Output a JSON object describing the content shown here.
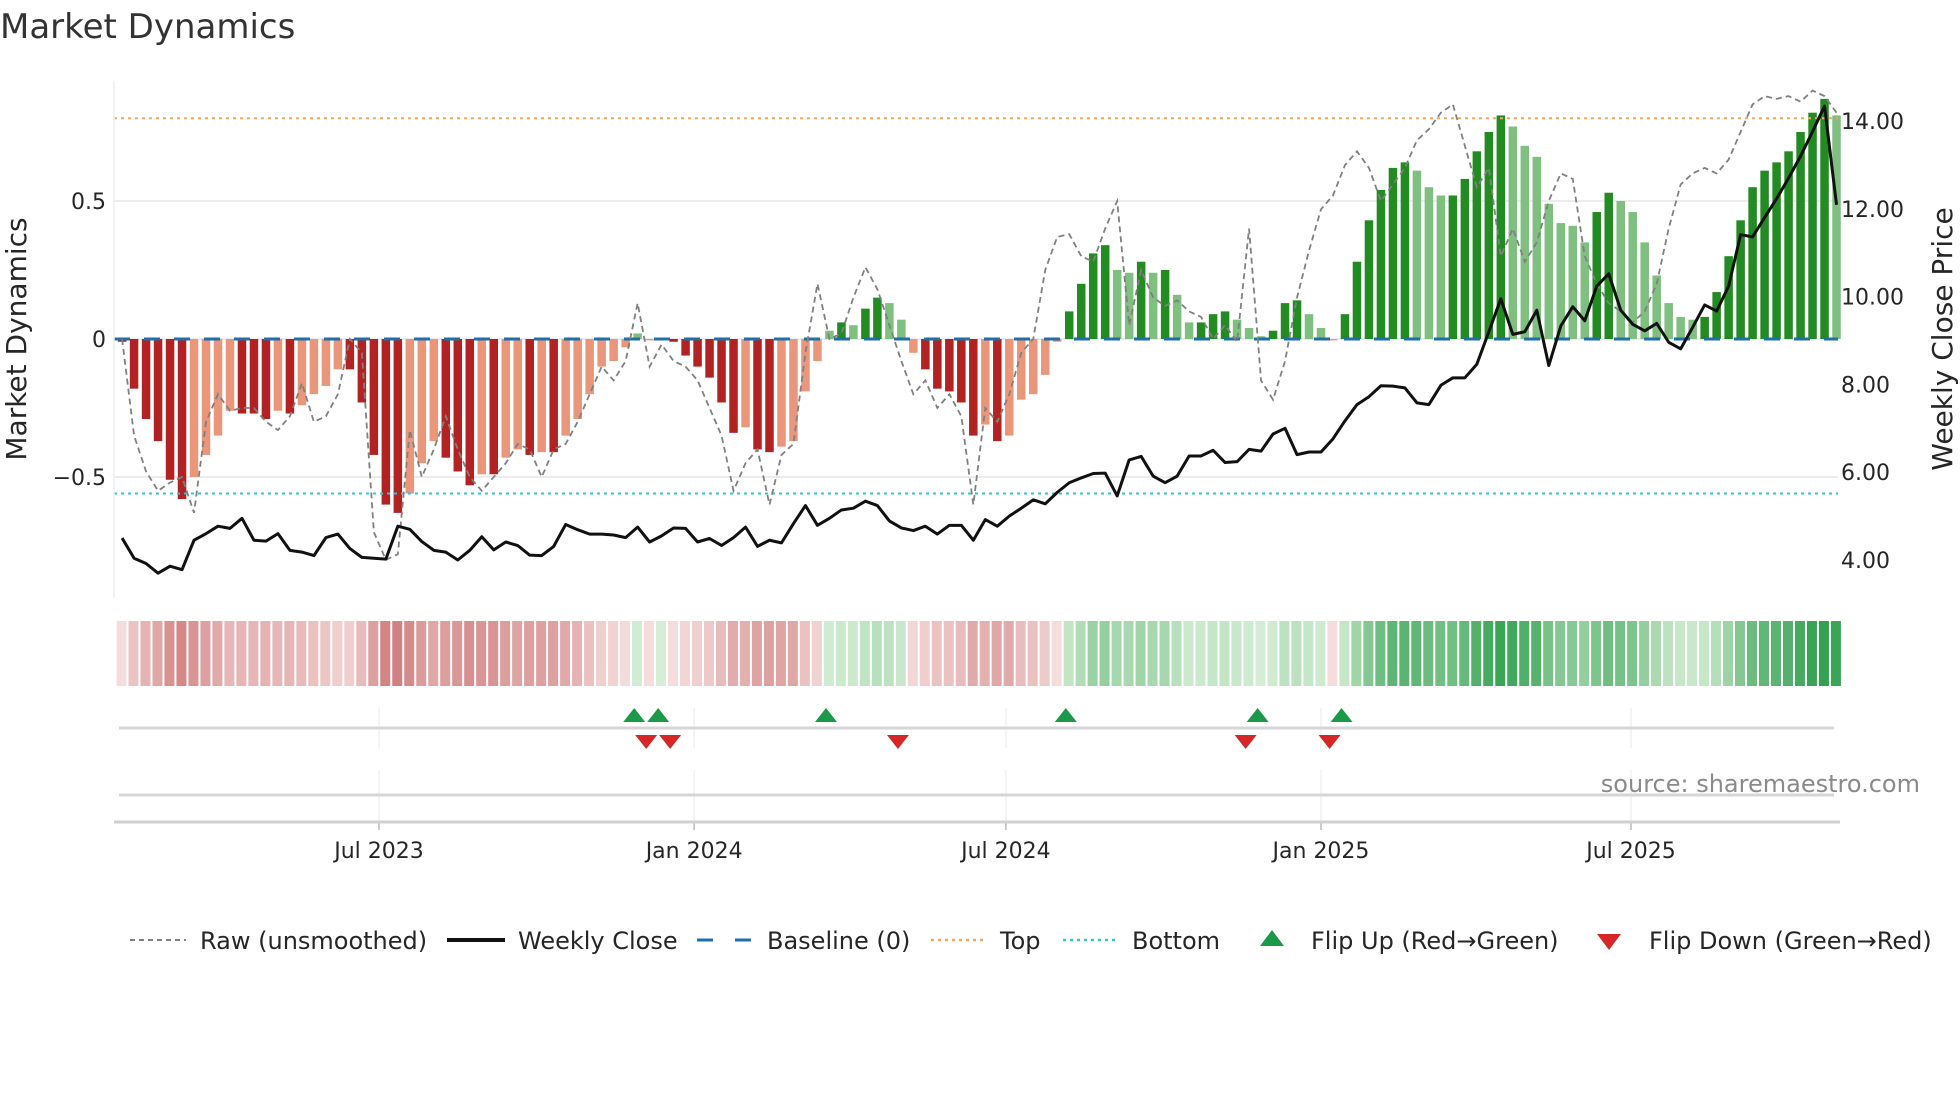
{
  "title": "Market Dynamics",
  "source": "source: sharemaestro.com",
  "chart_data": {
    "type": "bar",
    "title": "Market Dynamics",
    "ylabel": "Market Dynamics",
    "y2label": "Weekly Close Price",
    "x_interval": "weekly",
    "start_date": "2023-02-01",
    "ylim": [
      -0.94,
      0.935
    ],
    "y2lim": [
      3.13,
      14.9
    ],
    "yticks": [
      "0.5",
      "0",
      "−0.5"
    ],
    "ytick_values": [
      0.5,
      0,
      -0.5
    ],
    "y2ticks": [
      "14.00",
      "12.00",
      "10.00",
      "8.00",
      "6.00",
      "4.00"
    ],
    "y2tick_values": [
      14,
      12,
      10,
      8,
      6,
      4
    ],
    "xticks": [
      "Jul 2023",
      "Jan 2024",
      "Jul 2024",
      "Jan 2025",
      "Jul 2025"
    ],
    "xtick_dates": [
      "2023-07-01",
      "2024-01-01",
      "2024-07-01",
      "2025-01-01",
      "2025-07-01"
    ],
    "top_level": 0.8,
    "bottom_level": -0.56,
    "baseline": 0,
    "momentum": [
      -0.01,
      -0.18,
      -0.29,
      -0.37,
      -0.51,
      -0.58,
      -0.5,
      -0.42,
      -0.35,
      -0.26,
      -0.27,
      -0.27,
      -0.29,
      -0.26,
      -0.27,
      -0.24,
      -0.2,
      -0.17,
      -0.11,
      -0.11,
      -0.23,
      -0.42,
      -0.6,
      -0.63,
      -0.56,
      -0.45,
      -0.37,
      -0.43,
      -0.48,
      -0.53,
      -0.49,
      -0.49,
      -0.43,
      -0.4,
      -0.42,
      -0.41,
      -0.41,
      -0.35,
      -0.29,
      -0.2,
      -0.1,
      -0.08,
      -0.03,
      0.02,
      -0.005,
      0.004,
      -0.01,
      -0.06,
      -0.1,
      -0.14,
      -0.23,
      -0.34,
      -0.32,
      -0.4,
      -0.41,
      -0.39,
      -0.37,
      -0.19,
      -0.08,
      0.03,
      0.06,
      0.05,
      0.11,
      0.15,
      0.13,
      0.07,
      -0.05,
      -0.11,
      -0.18,
      -0.19,
      -0.23,
      -0.35,
      -0.31,
      -0.37,
      -0.35,
      -0.22,
      -0.2,
      -0.13,
      -0.01,
      0.1,
      0.2,
      0.31,
      0.34,
      0.25,
      0.24,
      0.28,
      0.24,
      0.25,
      0.16,
      0.06,
      0.06,
      0.09,
      0.1,
      0.07,
      0.04,
      0.01,
      0.03,
      0.13,
      0.14,
      0.09,
      0.04,
      -0.005,
      0.09,
      0.28,
      0.43,
      0.54,
      0.62,
      0.64,
      0.61,
      0.55,
      0.52,
      0.52,
      0.58,
      0.68,
      0.75,
      0.81,
      0.77,
      0.7,
      0.66,
      0.49,
      0.42,
      0.41,
      0.35,
      0.46,
      0.53,
      0.5,
      0.46,
      0.35,
      0.23,
      0.13,
      0.08,
      0.07,
      0.08,
      0.17,
      0.3,
      0.43,
      0.55,
      0.61,
      0.64,
      0.68,
      0.75,
      0.82,
      0.87,
      0.81
    ],
    "raw": [
      0.0,
      -0.35,
      -0.48,
      -0.55,
      -0.52,
      -0.5,
      -0.63,
      -0.3,
      -0.2,
      -0.26,
      -0.25,
      -0.25,
      -0.3,
      -0.33,
      -0.28,
      -0.16,
      -0.3,
      -0.28,
      -0.2,
      0.0,
      -0.05,
      -0.7,
      -0.8,
      -0.78,
      -0.33,
      -0.5,
      -0.4,
      -0.28,
      -0.4,
      -0.5,
      -0.55,
      -0.5,
      -0.45,
      -0.38,
      -0.4,
      -0.5,
      -0.4,
      -0.38,
      -0.3,
      -0.2,
      -0.1,
      -0.15,
      -0.08,
      0.13,
      -0.1,
      -0.02,
      -0.08,
      -0.1,
      -0.15,
      -0.25,
      -0.35,
      -0.55,
      -0.45,
      -0.4,
      -0.6,
      -0.42,
      -0.38,
      -0.05,
      0.2,
      0.0,
      0.02,
      0.15,
      0.26,
      0.18,
      0.05,
      -0.08,
      -0.2,
      -0.15,
      -0.25,
      -0.2,
      -0.28,
      -0.6,
      -0.25,
      -0.3,
      -0.2,
      -0.05,
      0.0,
      0.25,
      0.37,
      0.38,
      0.3,
      0.28,
      0.4,
      0.5,
      0.05,
      0.25,
      0.15,
      0.12,
      0.14,
      0.1,
      0.08,
      0.0,
      0.05,
      -0.01,
      0.4,
      -0.15,
      -0.22,
      -0.08,
      0.15,
      0.32,
      0.47,
      0.52,
      0.63,
      0.68,
      0.62,
      0.5,
      0.56,
      0.62,
      0.72,
      0.76,
      0.82,
      0.85,
      0.7,
      0.55,
      0.62,
      0.3,
      0.4,
      0.28,
      0.35,
      0.5,
      0.6,
      0.58,
      0.3,
      0.2,
      0.13,
      0.1,
      0.06,
      0.1,
      0.2,
      0.4,
      0.56,
      0.6,
      0.62,
      0.6,
      0.65,
      0.75,
      0.85,
      0.88,
      0.87,
      0.88,
      0.86,
      0.9,
      0.88,
      0.82
    ],
    "close": [
      4.5,
      4.04,
      3.92,
      3.7,
      3.86,
      3.78,
      4.45,
      4.6,
      4.77,
      4.72,
      4.95,
      4.45,
      4.43,
      4.6,
      4.22,
      4.18,
      4.1,
      4.51,
      4.59,
      4.26,
      4.06,
      4.04,
      4.02,
      4.77,
      4.7,
      4.42,
      4.22,
      4.18,
      4.0,
      4.22,
      4.53,
      4.23,
      4.41,
      4.33,
      4.11,
      4.1,
      4.31,
      4.81,
      4.69,
      4.59,
      4.59,
      4.57,
      4.51,
      4.75,
      4.41,
      4.55,
      4.73,
      4.72,
      4.41,
      4.49,
      4.33,
      4.51,
      4.75,
      4.31,
      4.45,
      4.39,
      4.83,
      5.24,
      4.79,
      4.95,
      5.14,
      5.18,
      5.34,
      5.24,
      4.89,
      4.73,
      4.67,
      4.77,
      4.59,
      4.79,
      4.79,
      4.45,
      4.92,
      4.77,
      5.0,
      5.18,
      5.37,
      5.28,
      5.54,
      5.76,
      5.87,
      5.97,
      5.98,
      5.46,
      6.28,
      6.36,
      5.91,
      5.76,
      5.91,
      6.37,
      6.37,
      6.5,
      6.22,
      6.24,
      6.52,
      6.48,
      6.87,
      7.0,
      6.4,
      6.46,
      6.46,
      6.76,
      7.17,
      7.54,
      7.72,
      7.97,
      7.96,
      7.92,
      7.58,
      7.54,
      7.98,
      8.15,
      8.15,
      8.46,
      9.2,
      9.95,
      9.14,
      9.2,
      9.69,
      8.43,
      9.33,
      9.77,
      9.45,
      10.24,
      10.52,
      9.69,
      9.37,
      9.22,
      9.39,
      8.96,
      8.81,
      9.3,
      9.81,
      9.67,
      10.24,
      11.41,
      11.36,
      11.8,
      12.23,
      12.7,
      13.2,
      13.76,
      14.34,
      12.09
    ],
    "flip_up": [
      "2023-11-27",
      "2023-12-11",
      "2024-03-18",
      "2024-08-05",
      "2024-11-25",
      "2025-01-13"
    ],
    "flip_down": [
      "2023-12-04",
      "2023-12-18",
      "2024-04-29",
      "2024-11-18",
      "2025-01-06"
    ],
    "legend_position": "bottom",
    "legend": [
      {
        "label": "Raw (unsmoothed)",
        "style": "raw"
      },
      {
        "label": "Weekly Close",
        "style": "close"
      },
      {
        "label": "Baseline (0)",
        "style": "baseline"
      },
      {
        "label": "Top",
        "style": "top"
      },
      {
        "label": "Bottom",
        "style": "bottom"
      },
      {
        "label": "Flip Up (Red→Green)",
        "style": "flip-up"
      },
      {
        "label": "Flip Down (Green→Red)",
        "style": "flip-down"
      }
    ],
    "colors": {
      "neg_strong": "#b22222",
      "neg_weak": "#e9967a",
      "pos_strong": "#228b22",
      "pos_weak": "#7fbf7f",
      "raw": "#808080",
      "close": "#111111",
      "baseline": "#1f6fa8",
      "top": "#f0a860",
      "bottom": "#2ec7d6",
      "flip_up": "#1a9a48",
      "flip_down": "#d62728"
    }
  }
}
